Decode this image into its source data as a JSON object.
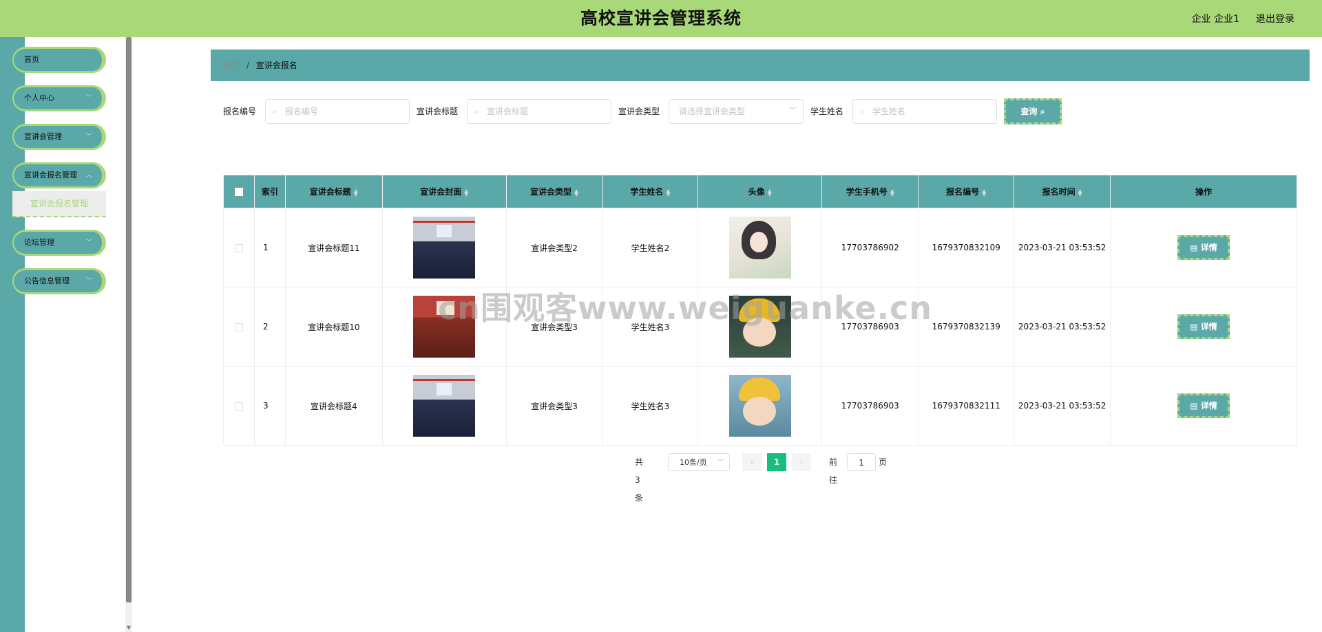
{
  "header": {
    "title": "高校宣讲会管理系统",
    "user": "企业 企业1",
    "logout": "退出登录"
  },
  "sidebar": {
    "items": [
      {
        "label": "首页",
        "chevron": false
      },
      {
        "label": "个人中心",
        "chevron": true
      },
      {
        "label": "宣讲会管理",
        "chevron": true
      },
      {
        "label": "宣讲会报名管理",
        "chevron": true
      },
      {
        "label": "论坛管理",
        "chevron": true
      },
      {
        "label": "公告信息管理",
        "chevron": true
      }
    ],
    "submenu_active": "宣讲会报名管理"
  },
  "breadcrumb": {
    "home": "首页",
    "sep": "/",
    "current": "宣讲会报名"
  },
  "search": {
    "f1_label": "报名编号",
    "f1_placeholder": "报名编号",
    "f2_label": "宣讲会标题",
    "f2_placeholder": "宣讲会标题",
    "f3_label": "宣讲会类型",
    "f3_placeholder": "请选择宣讲会类型",
    "f4_label": "学生姓名",
    "f4_placeholder": "学生姓名",
    "button": "查询"
  },
  "table": {
    "headers": [
      "索引",
      "宣讲会标题",
      "宣讲会封面",
      "宣讲会类型",
      "学生姓名",
      "头像",
      "学生手机号",
      "报名编号",
      "报名时间",
      "操作"
    ],
    "rows": [
      {
        "index": "1",
        "title": "宣讲会标题11",
        "type": "宣讲会类型2",
        "student": "学生姓名2",
        "phone": "17703786902",
        "regno": "1679370832109",
        "time": "2023-03-21 03:53:52",
        "action": "详情"
      },
      {
        "index": "2",
        "title": "宣讲会标题10",
        "type": "宣讲会类型3",
        "student": "学生姓名3",
        "phone": "17703786903",
        "regno": "1679370832139",
        "time": "2023-03-21 03:53:52",
        "action": "详情"
      },
      {
        "index": "3",
        "title": "宣讲会标题4",
        "type": "宣讲会类型3",
        "student": "学生姓名3",
        "phone": "17703786903",
        "regno": "1679370832111",
        "time": "2023-03-21 03:53:52",
        "action": "详情"
      }
    ]
  },
  "pagination": {
    "total": "共 3 条",
    "page_size": "10条/页",
    "current": "1",
    "goto_label": "前往",
    "goto_value": "1",
    "page_suffix": "页"
  },
  "watermark": "cn围观客www.weiguanke.cn",
  "colors": {
    "header": "#a8d878",
    "accent": "#5ba8a8",
    "page_active": "#19be7e"
  }
}
